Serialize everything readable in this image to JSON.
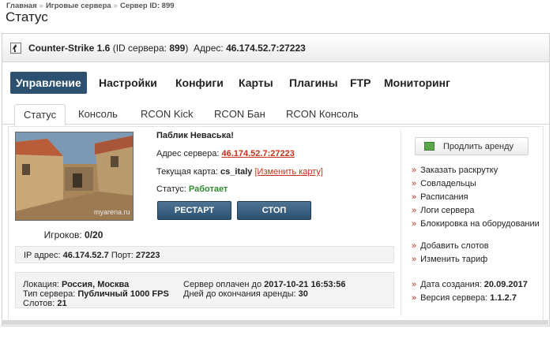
{
  "breadcrumb": [
    "Главная",
    "Игровые сервера",
    "Сервер ID: 899"
  ],
  "breadcrumb_sep": "»",
  "page_title": "Статус",
  "server": {
    "game": "Counter-Strike 1.6",
    "id_prefix": "(ID сервера:",
    "id": "899",
    "id_suffix": ")",
    "address_label": "Адрес:",
    "address": "46.174.52.7:27223"
  },
  "main_nav": [
    {
      "label": "Управление",
      "active": true
    },
    {
      "label": "Настройки"
    },
    {
      "label": "Конфиги"
    },
    {
      "label": "Карты"
    },
    {
      "label": "Плагины"
    },
    {
      "label": "FTP"
    },
    {
      "label": "Мониторинг"
    }
  ],
  "sub_tabs": [
    {
      "label": "Статус",
      "active": true
    },
    {
      "label": "Консоль"
    },
    {
      "label": "RCON Kick"
    },
    {
      "label": "RCON Бан"
    },
    {
      "label": "RCON Консоль"
    }
  ],
  "map_image_watermark": "myarena.ru",
  "players": {
    "label": "Игроков:",
    "value": "0/20"
  },
  "hostname": "Паблик Невaська!",
  "info": {
    "address_label": "Адрес сервера:",
    "address": "46.174.52.7:27223",
    "map_label": "Текущая карта:",
    "map": "cs_italy",
    "change_map": "[Изменить карту]",
    "status_label": "Статус:",
    "status": "Работает"
  },
  "buttons": {
    "restart": "РЕСТАРТ",
    "stop": "СТОП"
  },
  "ip": {
    "label": "IP адрес:",
    "value": "46.174.52.7",
    "port_label": "Порт:",
    "port": "27223"
  },
  "location": {
    "loc_label": "Локация:",
    "loc": "Россия, Москва",
    "type_label": "Тип сервера:",
    "type": "Публичный 1000 FPS",
    "slots_label": "Слотов:",
    "slots": "21",
    "paid_label": "Сервер оплачен до",
    "paid": "2017-10-21 16:53:56",
    "days_label": "Дней до окончания аренды:",
    "days": "30"
  },
  "rent_button": "Продлить аренду",
  "links": [
    "Заказать раскрутку",
    "Совладельцы",
    "Расписания",
    "Логи сервера",
    "Блокировка на оборудовании",
    "Добавить слотов",
    "Изменить тариф"
  ],
  "meta": {
    "created_label": "Дата создания:",
    "created": "20.09.2017",
    "version_label": "Версия сервера:",
    "version": "1.1.2.7"
  },
  "colors": {
    "nav_active": "#2b5070",
    "link": "#c5321c",
    "status_ok": "#2e8b2e"
  },
  "icons": [
    "counter-strike-icon",
    "rent-icon",
    "arrow-icon"
  ]
}
